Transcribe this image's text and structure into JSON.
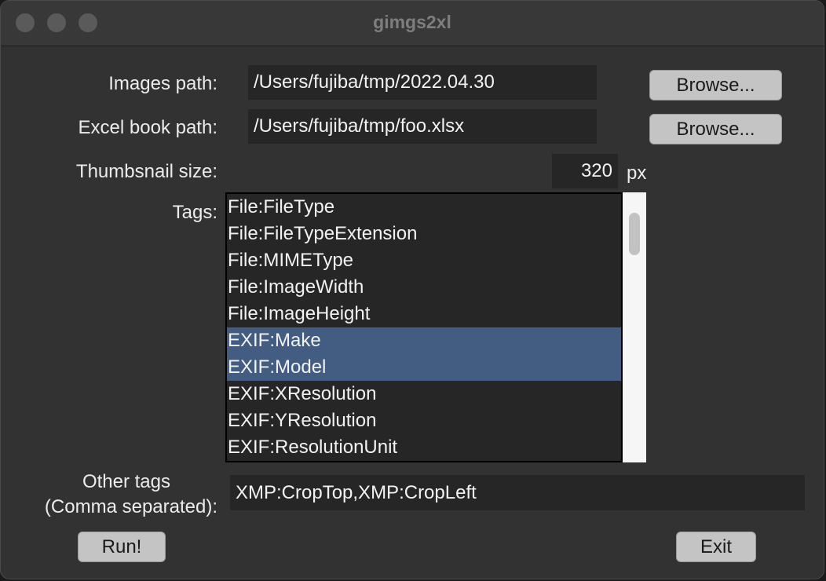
{
  "window": {
    "title": "gimgs2xl"
  },
  "form": {
    "images_path_label": "Images path:",
    "images_path_value": "/Users/fujiba/tmp/2022.04.30",
    "excel_path_label": "Excel book path:",
    "excel_path_value": "/Users/fujiba/tmp/foo.xlsx",
    "browse_label": "Browse...",
    "thumb_label": "Thumbsnail size:",
    "thumb_value": "320",
    "thumb_unit": "px",
    "tags_label": "Tags:",
    "tags": [
      {
        "label": "File:FileType",
        "selected": false
      },
      {
        "label": "File:FileTypeExtension",
        "selected": false
      },
      {
        "label": "File:MIMEType",
        "selected": false
      },
      {
        "label": "File:ImageWidth",
        "selected": false
      },
      {
        "label": "File:ImageHeight",
        "selected": false
      },
      {
        "label": "EXIF:Make",
        "selected": true
      },
      {
        "label": "EXIF:Model",
        "selected": true
      },
      {
        "label": "EXIF:XResolution",
        "selected": false
      },
      {
        "label": "EXIF:YResolution",
        "selected": false
      },
      {
        "label": "EXIF:ResolutionUnit",
        "selected": false
      }
    ],
    "other_tags_label_line1": "Other tags",
    "other_tags_label_line2": "(Comma separated):",
    "other_tags_value": "XMP:CropTop,XMP:CropLeft"
  },
  "actions": {
    "run_label": "Run!",
    "exit_label": "Exit"
  },
  "colors": {
    "window_bg": "#323232",
    "field_bg": "#262626",
    "selection": "#435d82",
    "button_bg": "#c4c4c4"
  }
}
